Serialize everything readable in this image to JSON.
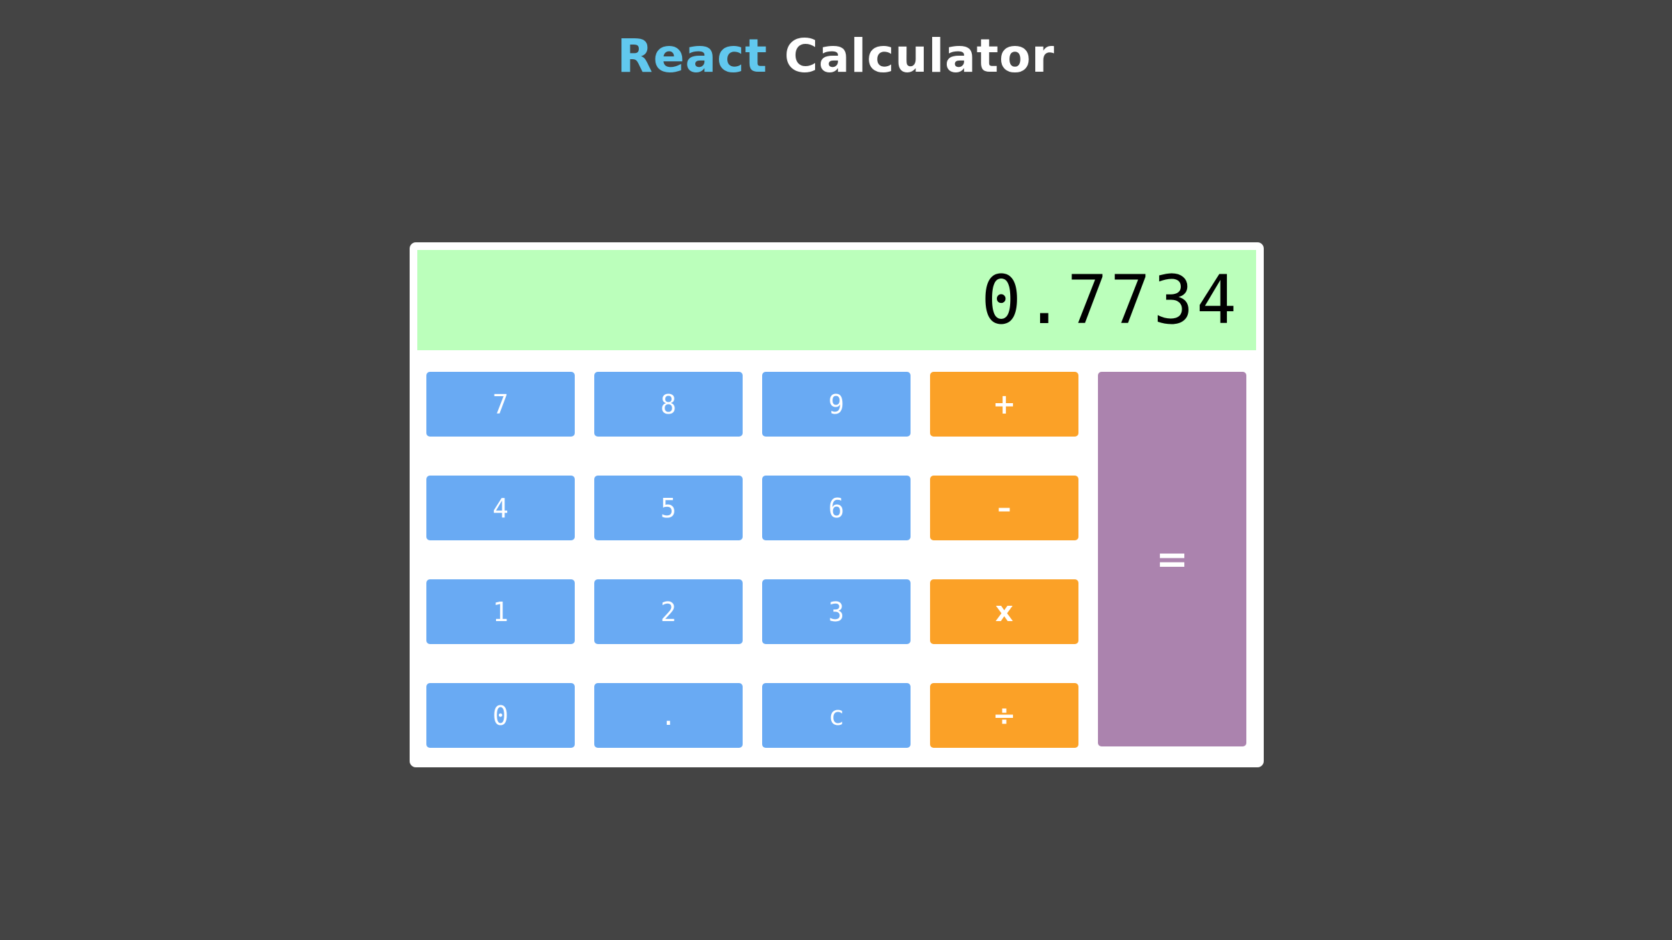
{
  "title": {
    "part1": "React",
    "part2": "Calculator"
  },
  "display": {
    "value": "0.7734"
  },
  "keys": {
    "k7": "7",
    "k8": "8",
    "k9": "9",
    "k4": "4",
    "k5": "5",
    "k6": "6",
    "k1": "1",
    "k2": "2",
    "k3": "3",
    "k0": "0",
    "dot": ".",
    "clear": "c",
    "add": "+",
    "subtract": "–",
    "multiply": "x",
    "divide": "÷",
    "equals": "="
  },
  "colors": {
    "background": "#444444",
    "react_title": "#61c8ee",
    "display_bg": "#bbffbb",
    "number_key": "#69aaf3",
    "operator_key": "#fba127",
    "equals_key": "#ab83ae"
  }
}
